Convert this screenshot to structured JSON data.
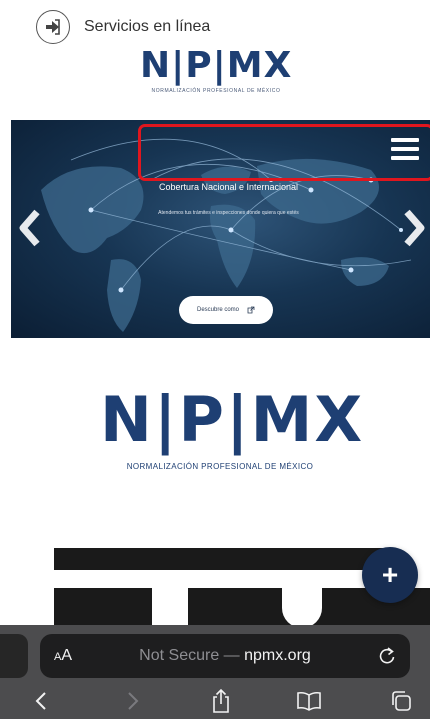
{
  "header": {
    "services_link": "Servicios en línea",
    "logo_text": "N|P|MX",
    "logo_subtitle": "NORMALIZACIÓN PROFESIONAL DE MÉXICO"
  },
  "hero": {
    "title": "Cobertura Nacional e Internacional",
    "subtitle": "Atendemos tus trámites e inspecciones donde quiera que estés",
    "button_label": "Descubre como"
  },
  "main": {
    "logo_text": "N|P|MX",
    "logo_subtitle": "NORMALIZACIÓN PROFESIONAL DE MÉXICO"
  },
  "fab": {
    "label": "+"
  },
  "browser": {
    "text_size_small": "A",
    "text_size_large": "A",
    "url_prefix": "Not Secure — ",
    "url_domain": "npmx.org"
  },
  "colors": {
    "brand_navy": "#1e3f73",
    "highlight_red": "#e0161e",
    "fab_bg": "#172d52",
    "toolbar_bg": "#4c4c4e"
  },
  "icons": [
    "login-arrow-icon",
    "chevron-left-icon",
    "chevron-right-icon",
    "hamburger-menu-icon",
    "external-link-icon",
    "plus-icon",
    "reload-icon",
    "back-icon",
    "forward-icon",
    "share-icon",
    "bookmarks-icon",
    "tabs-icon"
  ]
}
